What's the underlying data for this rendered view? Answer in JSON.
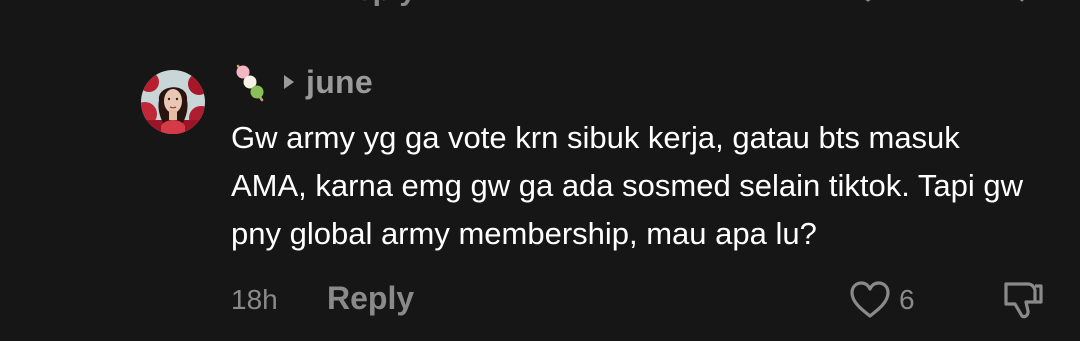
{
  "previous_comment": {
    "reply_fragment": "eply"
  },
  "comment": {
    "avatar_icon": "profile-photo",
    "flair_icon": "dango-emoji",
    "badge_icon": "triangle-right-icon",
    "username": "june",
    "text": "Gw army yg ga vote krn sibuk kerja, gatau bts masuk AMA, karna emg gw ga ada sosmed selain tiktok. Tapi gw pny global army membership, mau apa lu?",
    "timestamp": "18h",
    "reply_label": "Reply",
    "like_count": "6"
  },
  "colors": {
    "background": "#161616",
    "text": "#ffffff",
    "muted": "#8a8a8a"
  }
}
